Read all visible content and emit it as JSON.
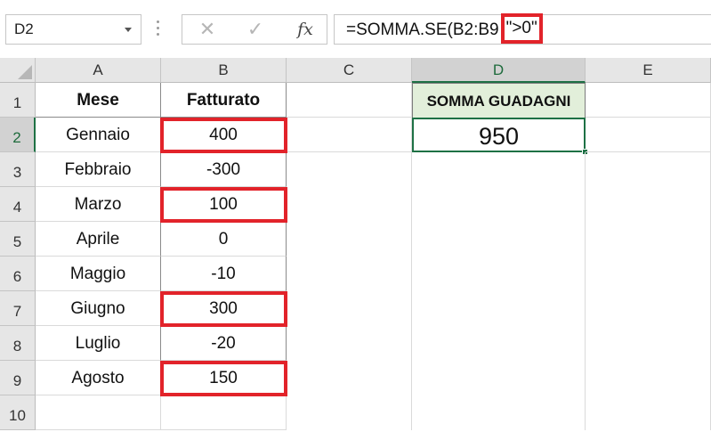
{
  "formula_bar": {
    "name_box": "D2",
    "cancel_icon": "✕",
    "enter_icon": "✓",
    "fx_label": "fx",
    "formula_prefix": "=SOMMA.SE(B2:B9",
    "formula_highlight": "\">0\""
  },
  "columns": [
    "A",
    "B",
    "C",
    "D",
    "E"
  ],
  "active_column": "D",
  "rows": [
    "1",
    "2",
    "3",
    "4",
    "5",
    "6",
    "7",
    "8",
    "9",
    "10"
  ],
  "active_row": "2",
  "table": {
    "headers": {
      "mese": "Mese",
      "fatturato": "Fatturato"
    },
    "rows": [
      {
        "mese": "Gennaio",
        "fatturato": "400",
        "highlighted": true
      },
      {
        "mese": "Febbraio",
        "fatturato": "-300",
        "highlighted": false
      },
      {
        "mese": "Marzo",
        "fatturato": "100",
        "highlighted": true
      },
      {
        "mese": "Aprile",
        "fatturato": "0",
        "highlighted": false
      },
      {
        "mese": "Maggio",
        "fatturato": "-10",
        "highlighted": false
      },
      {
        "mese": "Giugno",
        "fatturato": "300",
        "highlighted": true
      },
      {
        "mese": "Luglio",
        "fatturato": "-20",
        "highlighted": false
      },
      {
        "mese": "Agosto",
        "fatturato": "150",
        "highlighted": true
      }
    ]
  },
  "summary": {
    "label": "SOMMA GUADAGNI",
    "value": "950"
  },
  "colors": {
    "highlight_red": "#e2232a",
    "active_green": "#1e7145",
    "summary_fill": "#e2efda"
  }
}
